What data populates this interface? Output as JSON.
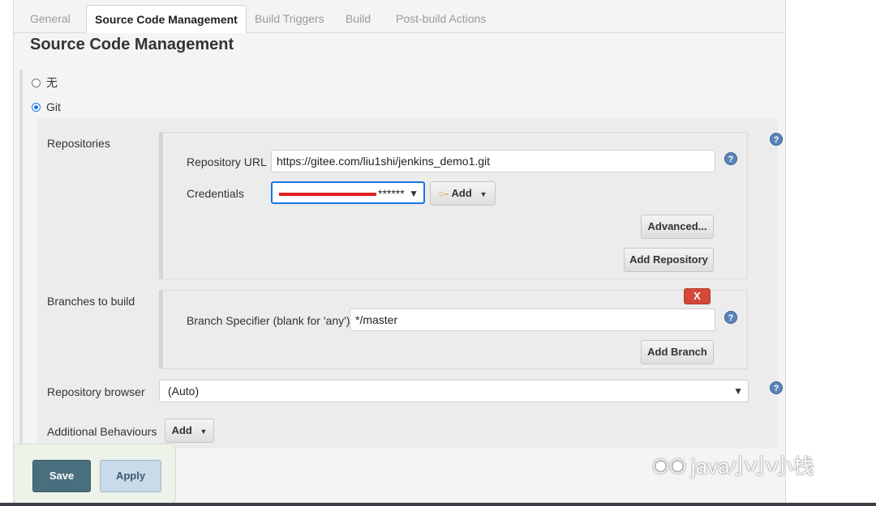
{
  "tabs": [
    {
      "label": "General"
    },
    {
      "label": "Source Code Management"
    },
    {
      "label": "Build Triggers"
    },
    {
      "label": "Build"
    },
    {
      "label": "Post-build Actions"
    }
  ],
  "section_title": "Source Code Management",
  "scm_options": [
    {
      "label": "无",
      "checked": false
    },
    {
      "label": "Git",
      "checked": true
    }
  ],
  "repositories": {
    "label": "Repositories",
    "url_label": "Repository URL",
    "url_value": "https://gitee.com/liu1shi/jenkins_demo1.git",
    "credentials_label": "Credentials",
    "credentials_value": "******",
    "add_button": "Add",
    "advanced_button": "Advanced...",
    "add_repository_button": "Add Repository"
  },
  "branches": {
    "label": "Branches to build",
    "delete_button": "X",
    "specifier_label": "Branch Specifier (blank for 'any')",
    "specifier_value": "*/master",
    "add_branch_button": "Add Branch"
  },
  "repository_browser": {
    "label": "Repository browser",
    "value": "(Auto)"
  },
  "additional_behaviours": {
    "label": "Additional Behaviours",
    "add_button": "Add"
  },
  "help_glyph": "?",
  "footer": {
    "save": "Save",
    "apply": "Apply"
  },
  "watermark": {
    "text": "java小小小栈"
  },
  "colors": {
    "save_bg": "#486f7e",
    "apply_bg": "#c9dbe8",
    "delete_bg": "#d24939",
    "help_bg": "#5a84b8",
    "focus_border": "#1a73e8"
  }
}
